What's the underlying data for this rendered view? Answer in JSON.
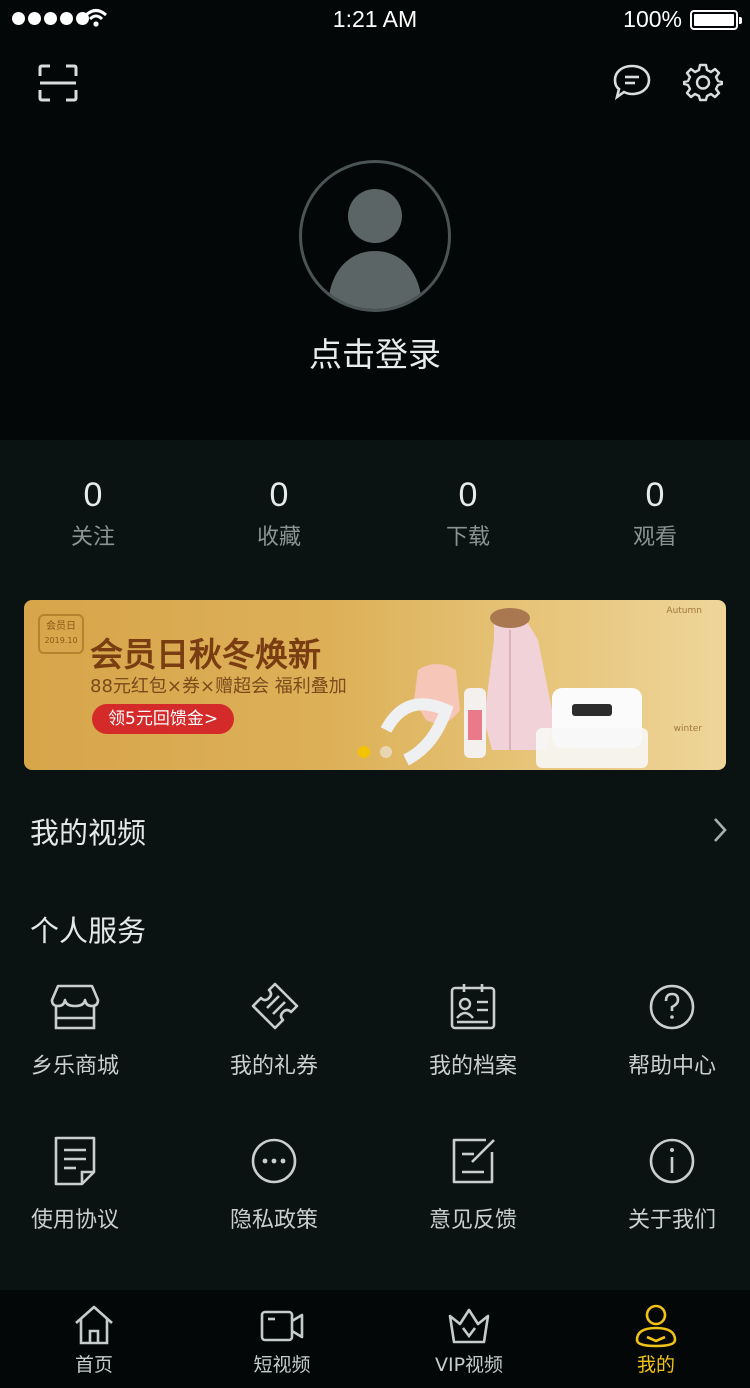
{
  "status_bar": {
    "time": "1:21 AM",
    "battery": "100%"
  },
  "header": {
    "login_label": "点击登录"
  },
  "stats": [
    {
      "value": "0",
      "label": "关注"
    },
    {
      "value": "0",
      "label": "收藏"
    },
    {
      "value": "0",
      "label": "下载"
    },
    {
      "value": "0",
      "label": "观看"
    }
  ],
  "banner": {
    "badge_line1": "会员日",
    "badge_line2": "2019.10",
    "title": "会员日秋冬焕新",
    "subtitle": "88元红包×券×赠超会 福利叠加",
    "cta": "领5元回馈金>",
    "side_top": "Autumn",
    "side_bottom": "winter",
    "dot_active_color": "#f5c200",
    "dot_inactive_color": "#e8d6b3"
  },
  "my_video": {
    "label": "我的视频"
  },
  "services": {
    "title": "个人服务",
    "items": [
      {
        "label": "乡乐商城",
        "icon": "store-icon"
      },
      {
        "label": "我的礼券",
        "icon": "ticket-icon"
      },
      {
        "label": "我的档案",
        "icon": "profile-card-icon"
      },
      {
        "label": "帮助中心",
        "icon": "help-icon"
      },
      {
        "label": "使用协议",
        "icon": "document-icon"
      },
      {
        "label": "隐私政策",
        "icon": "more-dots-icon"
      },
      {
        "label": "意见反馈",
        "icon": "feedback-edit-icon"
      },
      {
        "label": "关于我们",
        "icon": "info-icon"
      }
    ]
  },
  "tabbar": {
    "accent_color": "#f2c317",
    "items": [
      {
        "label": "首页",
        "icon": "home-icon"
      },
      {
        "label": "短视频",
        "icon": "video-icon"
      },
      {
        "label": "VIP视频",
        "icon": "crown-icon"
      },
      {
        "label": "我的",
        "icon": "user-icon",
        "active": true
      }
    ]
  }
}
